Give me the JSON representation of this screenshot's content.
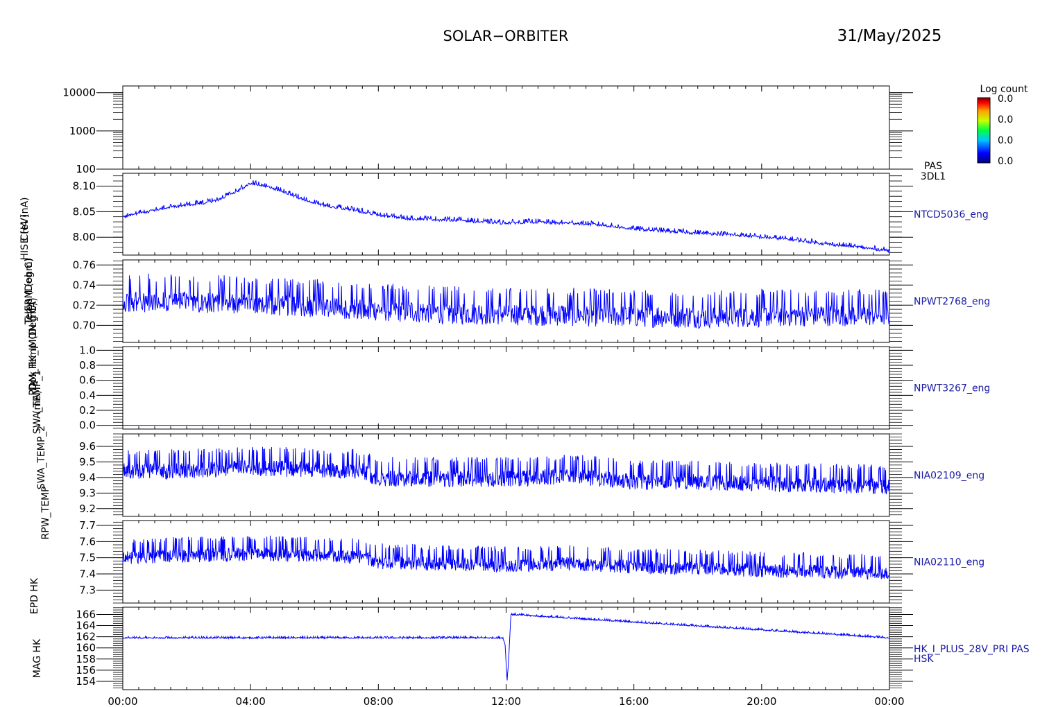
{
  "header": {
    "title": "SOLAR−ORBITER",
    "date": "31/May/2025"
  },
  "colorbar": {
    "title": "Log count",
    "tick_labels": [
      "0.0",
      "0.0",
      "0.0",
      "0.0"
    ]
  },
  "colors": {
    "trace": "#0000ff",
    "axis": "#000000",
    "panel_label": "#1a1aa6"
  },
  "y_axis_titles_overprinted": [
    "E (eV)",
    "Temp (Deg C)",
    "Dpx Temp (Deg C)",
    "SWA_TEMP_1",
    "SWA_TEMP_2",
    "RPW_TEMP",
    "EPD HK",
    "MAG HK",
    "HIS CH4 (nA)",
    "THERM (ohm)",
    "PDM_HK_IMON (mA)",
    "(mA)"
  ],
  "chart_data": [
    {
      "type": "heatmap",
      "id": "pas_3dl1",
      "right_label": [
        "PAS",
        "3DL1"
      ],
      "y_scale": "log",
      "ylim": [
        100,
        15000
      ],
      "y_tick_labels": [
        "10000",
        "1000",
        "100"
      ],
      "x_tick_labels": [
        "00:00",
        "04:00",
        "08:00",
        "12:00",
        "16:00",
        "20:00",
        "00:00"
      ],
      "xlim_hours": [
        0,
        24
      ],
      "values": []
    },
    {
      "type": "line",
      "id": "ntcd5036",
      "right_label": [
        "NTCD5036_eng"
      ],
      "ylim": [
        7.965,
        8.125
      ],
      "y_ticks": [
        8.1,
        8.05,
        8.0
      ],
      "y_tick_labels": [
        "8.10",
        "8.05",
        "8.00"
      ],
      "x_hours": [
        0,
        0.5,
        1,
        1.5,
        2,
        2.5,
        3,
        3.5,
        4,
        4.5,
        5,
        5.5,
        6,
        6.5,
        7,
        7.5,
        8,
        8.5,
        9,
        9.5,
        10,
        10.5,
        11,
        11.5,
        12,
        12.5,
        13,
        13.5,
        14,
        14.5,
        15,
        15.5,
        16,
        16.5,
        17,
        17.5,
        18,
        18.5,
        19,
        19.5,
        20,
        20.5,
        21,
        21.5,
        22,
        22.5,
        23,
        23.5,
        24
      ],
      "values": [
        8.04,
        8.047,
        8.053,
        8.059,
        8.064,
        8.066,
        8.074,
        8.087,
        8.106,
        8.1,
        8.09,
        8.078,
        8.067,
        8.06,
        8.056,
        8.05,
        8.043,
        8.04,
        8.036,
        8.036,
        8.034,
        8.034,
        8.031,
        8.029,
        8.028,
        8.029,
        8.03,
        8.028,
        8.028,
        8.026,
        8.024,
        8.02,
        8.016,
        8.014,
        8.012,
        8.01,
        8.008,
        8.007,
        8.005,
        8.003,
        8.0,
        7.998,
        7.995,
        7.991,
        7.987,
        7.984,
        7.981,
        7.977,
        7.974
      ],
      "noise_amplitude": 0.003
    },
    {
      "type": "line",
      "id": "npwt2768",
      "right_label": [
        "NPWT2768_eng"
      ],
      "ylim": [
        0.683,
        0.765
      ],
      "y_ticks": [
        0.76,
        0.74,
        0.72,
        0.7
      ],
      "y_tick_labels": [
        "0.76",
        "0.74",
        "0.72",
        "0.70"
      ],
      "x_hours": [
        0,
        2,
        4,
        6,
        8,
        10,
        12,
        14,
        16,
        18,
        20,
        22,
        24
      ],
      "values": [
        0.725,
        0.725,
        0.723,
        0.72,
        0.716,
        0.713,
        0.712,
        0.711,
        0.71,
        0.709,
        0.71,
        0.711,
        0.711
      ],
      "noise_amplitude": 0.012
    },
    {
      "type": "line",
      "id": "npwt3267",
      "right_label": [
        "NPWT3267_eng"
      ],
      "ylim": [
        -0.05,
        1.05
      ],
      "y_ticks": [
        1.0,
        0.8,
        0.6,
        0.4,
        0.2,
        0.0
      ],
      "y_tick_labels": [
        "1.0",
        "0.8",
        "0.6",
        "0.4",
        "0.2",
        "0.0"
      ],
      "x_hours": [
        0,
        24
      ],
      "values": [
        0.0,
        0.0
      ],
      "noise_amplitude": 0
    },
    {
      "type": "line",
      "id": "nia02109",
      "right_label": [
        "NIA02109_eng"
      ],
      "ylim": [
        9.15,
        9.68
      ],
      "y_ticks": [
        9.6,
        9.5,
        9.4,
        9.3,
        9.2
      ],
      "y_tick_labels": [
        "9.6",
        "9.5",
        "9.4",
        "9.3",
        "9.2"
      ],
      "x_hours": [
        0,
        2,
        4,
        6,
        7.5,
        8,
        10,
        12,
        14,
        16,
        18,
        20,
        22,
        24
      ],
      "values": [
        9.45,
        9.45,
        9.47,
        9.46,
        9.45,
        9.4,
        9.4,
        9.4,
        9.42,
        9.38,
        9.38,
        9.37,
        9.36,
        9.35
      ],
      "noise_amplitude": 0.06
    },
    {
      "type": "line",
      "id": "nia02110",
      "right_label": [
        "NIA02110_eng"
      ],
      "ylim": [
        7.22,
        7.73
      ],
      "y_ticks": [
        7.7,
        7.6,
        7.5,
        7.4,
        7.3
      ],
      "y_tick_labels": [
        "7.7",
        "7.6",
        "7.5",
        "7.4",
        "7.3"
      ],
      "x_hours": [
        0,
        2,
        4,
        6,
        7.5,
        8,
        10,
        12,
        14,
        16,
        18,
        20,
        22,
        24
      ],
      "values": [
        7.51,
        7.52,
        7.53,
        7.52,
        7.51,
        7.48,
        7.47,
        7.46,
        7.47,
        7.45,
        7.44,
        7.43,
        7.42,
        7.41
      ],
      "noise_amplitude": 0.05
    },
    {
      "type": "line",
      "id": "hk_i_plus_28v",
      "right_label": [
        "HK_I_PLUS_28V_PRI PAS",
        "HSK"
      ],
      "ylim": [
        152.5,
        167.3
      ],
      "y_ticks": [
        166,
        164,
        162,
        160,
        158,
        156,
        154
      ],
      "y_tick_labels": [
        "166",
        "164",
        "162",
        "160",
        "158",
        "156",
        "154"
      ],
      "x_hours": [
        0,
        11.9,
        11.97,
        12.03,
        12.08,
        12.15,
        24
      ],
      "values": [
        161.8,
        161.8,
        160.5,
        154.0,
        158.0,
        166.0,
        161.8
      ],
      "noise_amplitude": 0.12
    }
  ]
}
